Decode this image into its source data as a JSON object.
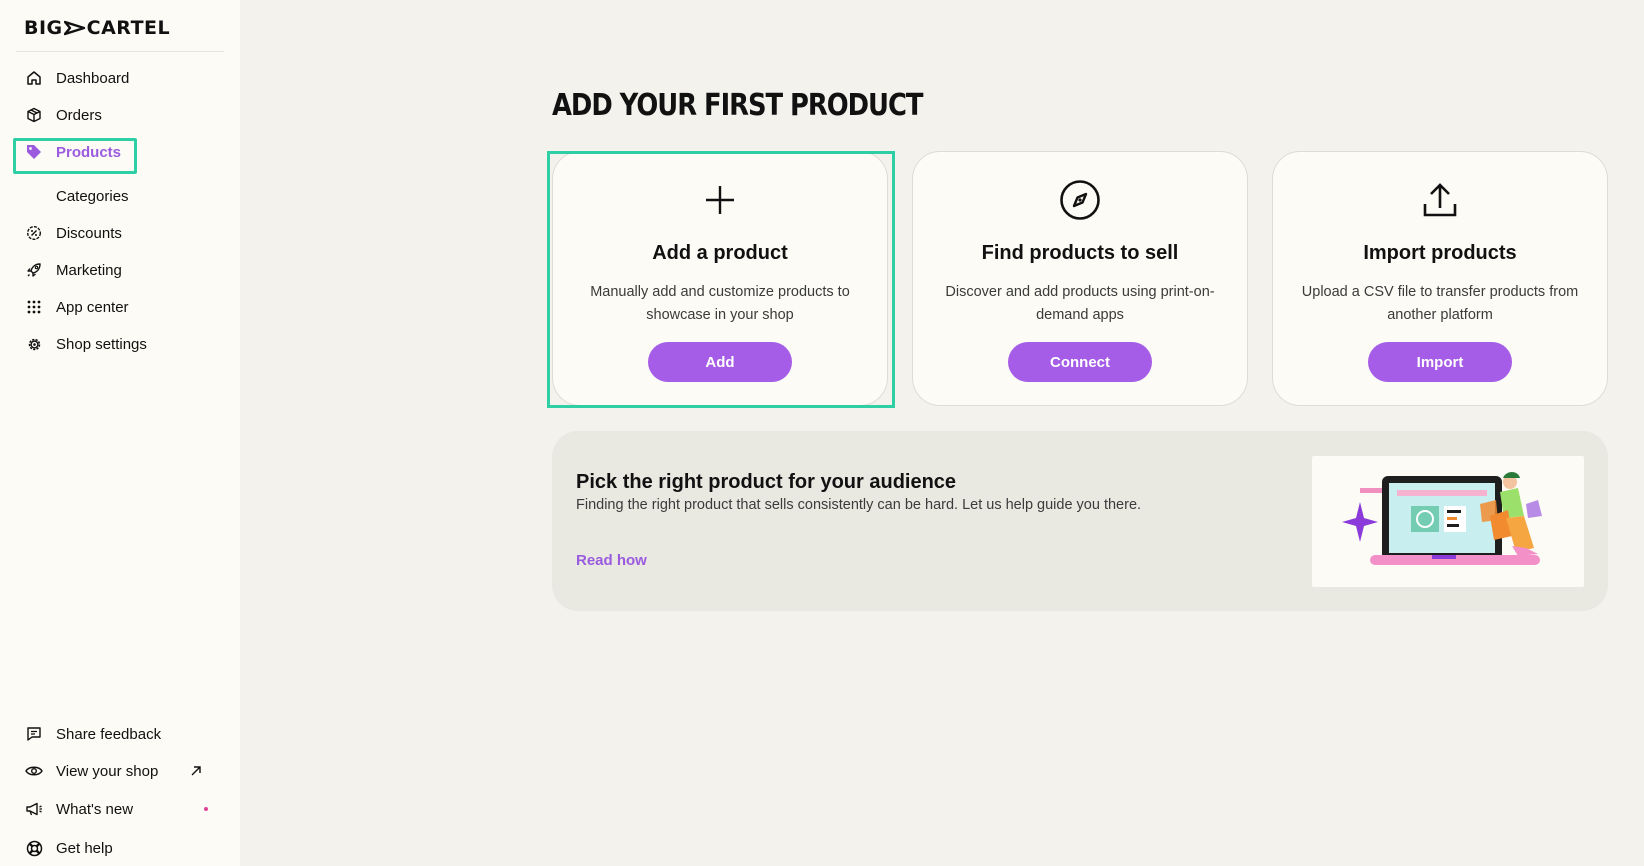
{
  "brand": {
    "logo_left": "BIG",
    "logo_right": "CARTEL"
  },
  "sidebar": {
    "items": [
      {
        "label": "Dashboard",
        "icon": "home-icon"
      },
      {
        "label": "Orders",
        "icon": "box-icon"
      },
      {
        "label": "Products",
        "icon": "tag-icon",
        "active": true
      },
      {
        "label": "Categories",
        "sub": true
      },
      {
        "label": "Discounts",
        "icon": "discount-icon"
      },
      {
        "label": "Marketing",
        "icon": "rocket-icon"
      },
      {
        "label": "App center",
        "icon": "grid-icon"
      },
      {
        "label": "Shop settings",
        "icon": "gear-icon"
      }
    ],
    "bottom_items": [
      {
        "label": "Share feedback",
        "icon": "feedback-icon"
      },
      {
        "label": "View your shop",
        "icon": "eye-icon",
        "external_icon": "arrow-up-right-icon"
      },
      {
        "label": "What's new",
        "icon": "megaphone-icon",
        "badge_dot": true
      },
      {
        "label": "Get help",
        "icon": "lifebuoy-icon"
      }
    ]
  },
  "main": {
    "title": "ADD YOUR FIRST PRODUCT",
    "cards": [
      {
        "icon": "plus-icon",
        "title": "Add a product",
        "description": "Manually add and customize products to showcase in your shop",
        "button": "Add"
      },
      {
        "icon": "compass-icon",
        "title": "Find products to sell",
        "description": "Discover and add products using print-on-demand apps",
        "button": "Connect"
      },
      {
        "icon": "upload-icon",
        "title": "Import products",
        "description": "Upload a CSV file to transfer products from another platform",
        "button": "Import"
      }
    ],
    "promo": {
      "title": "Pick the right product for your audience",
      "description": "Finding the right product that sells consistently can be hard. Let us help guide you there.",
      "link": "Read how",
      "illustration": "laptop-shopping-illustration"
    }
  },
  "colors": {
    "accent": "#a55ce6",
    "active_text": "#9a5bdf",
    "highlight": "#2fcfa5",
    "background": "#f3f2ec",
    "sidebar": "#fcfbf5"
  }
}
